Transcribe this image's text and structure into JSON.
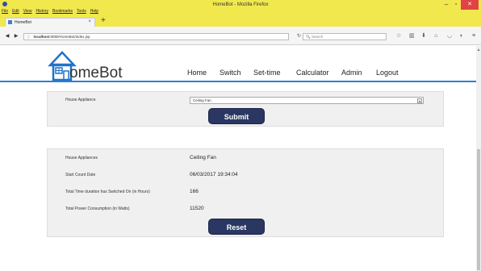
{
  "window": {
    "title": "HomeBot - Mozilla Firefox",
    "controls": {
      "minimize": "–",
      "maximize": "▫",
      "close": "✕"
    }
  },
  "menu": [
    "File",
    "Edit",
    "View",
    "History",
    "Bookmarks",
    "Tools",
    "Help"
  ],
  "tab": {
    "label": "HomeBot",
    "close": "×",
    "new_tab": "+"
  },
  "navbar": {
    "url_host": "localhost",
    "url_path": ":8080/HomeBot/index.jsp",
    "search_placeholder": "Search",
    "icons": [
      "back-icon",
      "forward-icon",
      "info-icon",
      "reload-icon",
      "star-icon",
      "library-icon",
      "download-icon",
      "home-icon",
      "pocket-icon",
      "sync-icon",
      "menu-icon"
    ]
  },
  "site": {
    "logo_text": "omeBot",
    "nav": [
      "Home",
      "Switch",
      "Set-time",
      "Calculator",
      "Admin",
      "Logout"
    ]
  },
  "form": {
    "appliance_label": "House Appliance",
    "appliance_value": "Ceiling Fan",
    "submit_label": "Submit"
  },
  "results": {
    "rows": [
      {
        "label": "House Appliances",
        "value": "Ceiling Fan"
      },
      {
        "label": "Start Count Date",
        "value": "06/03/2017 19:34:04"
      },
      {
        "label": "Total Time duration has Switched On (in Hours)",
        "value": "166"
      },
      {
        "label": "Total Power Consumption (in Watts)",
        "value": "11520"
      }
    ],
    "reset_label": "Reset"
  }
}
